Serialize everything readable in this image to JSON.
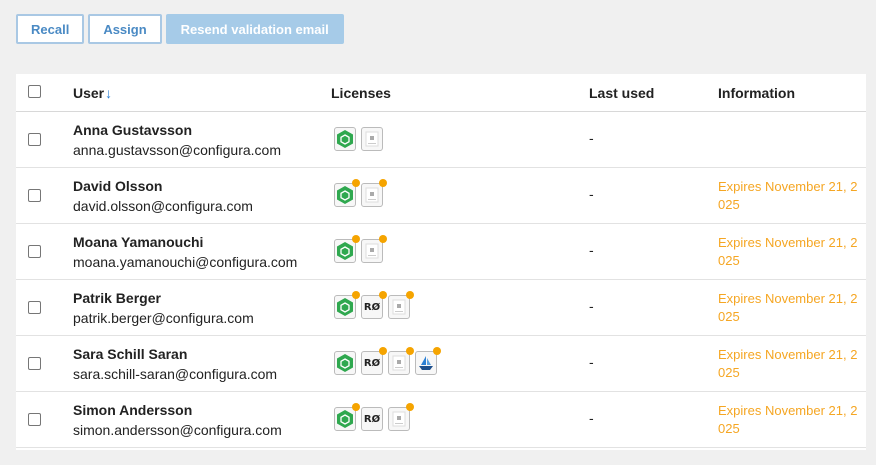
{
  "toolbar": {
    "recall": "Recall",
    "assign": "Assign",
    "resend": "Resend validation email"
  },
  "columns": {
    "user": "User",
    "sort_indicator": "↓",
    "licenses": "Licenses",
    "last_used": "Last used",
    "information": "Information"
  },
  "license_icons": {
    "configura": "hexagon-icon",
    "generic": "document-icon",
    "ro": "RØ",
    "ship": "ship-icon"
  },
  "colors": {
    "accent": "#4a8ac4",
    "warning": "#f5a623",
    "pending_dot": "#f5a400",
    "license_green": "#2fa84f"
  },
  "users": [
    {
      "name": "Anna Gustavsson",
      "email": "anna.gustavsson@configura.com",
      "last_used": "-",
      "info": "",
      "licenses": [
        {
          "type": "configura",
          "pending": false
        },
        {
          "type": "generic",
          "pending": false
        }
      ]
    },
    {
      "name": "David Olsson",
      "email": "david.olsson@configura.com",
      "last_used": "-",
      "info": "Expires November 21, 2025",
      "licenses": [
        {
          "type": "configura",
          "pending": true
        },
        {
          "type": "generic",
          "pending": true
        }
      ]
    },
    {
      "name": "Moana Yamanouchi",
      "email": "moana.yamanouchi@configura.com",
      "last_used": "-",
      "info": "Expires November 21, 2025",
      "licenses": [
        {
          "type": "configura",
          "pending": true
        },
        {
          "type": "generic",
          "pending": true
        }
      ]
    },
    {
      "name": "Patrik Berger",
      "email": "patrik.berger@configura.com",
      "last_used": "-",
      "info": "Expires November 21, 2025",
      "licenses": [
        {
          "type": "configura",
          "pending": true
        },
        {
          "type": "ro",
          "pending": true
        },
        {
          "type": "generic",
          "pending": true
        }
      ]
    },
    {
      "name": "Sara Schill Saran",
      "email": "sara.schill-saran@configura.com",
      "last_used": "-",
      "info": "Expires November 21, 2025",
      "licenses": [
        {
          "type": "configura",
          "pending": false
        },
        {
          "type": "ro",
          "pending": true
        },
        {
          "type": "generic",
          "pending": true
        },
        {
          "type": "ship",
          "pending": true
        }
      ]
    },
    {
      "name": "Simon Andersson",
      "email": "simon.andersson@configura.com",
      "last_used": "-",
      "info": "Expires November 21, 2025",
      "licenses": [
        {
          "type": "configura",
          "pending": true
        },
        {
          "type": "ro",
          "pending": false
        },
        {
          "type": "generic",
          "pending": true
        }
      ]
    }
  ]
}
